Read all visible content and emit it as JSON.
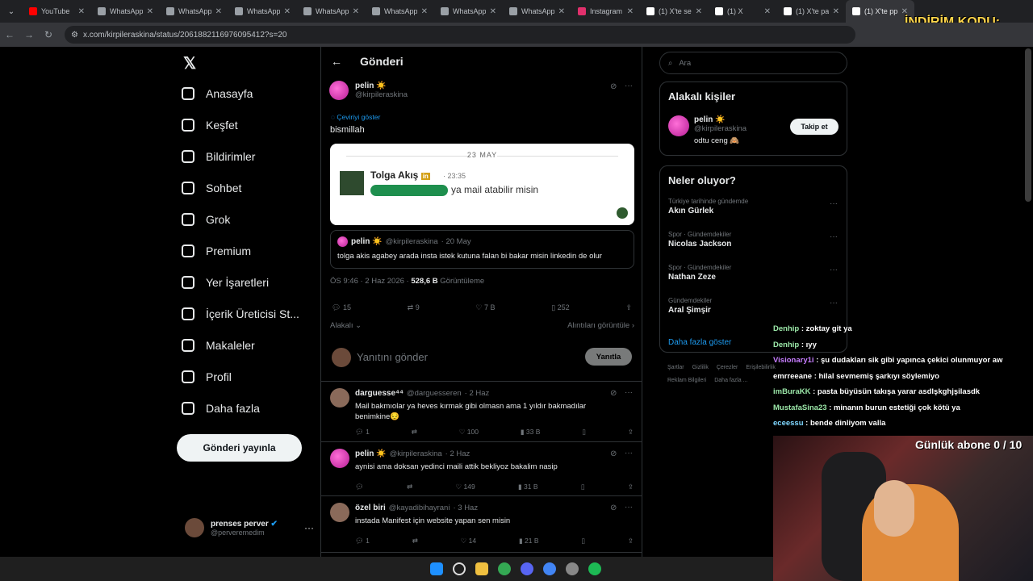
{
  "browser": {
    "tabs": [
      {
        "title": "YouTube",
        "color": "#ff0000"
      },
      {
        "title": "WhatsApp",
        "color": "#9aa0a6"
      },
      {
        "title": "WhatsApp",
        "color": "#9aa0a6"
      },
      {
        "title": "WhatsApp",
        "color": "#9aa0a6"
      },
      {
        "title": "WhatsApp",
        "color": "#9aa0a6"
      },
      {
        "title": "WhatsApp",
        "color": "#9aa0a6"
      },
      {
        "title": "WhatsApp",
        "color": "#9aa0a6"
      },
      {
        "title": "WhatsApp",
        "color": "#9aa0a6"
      },
      {
        "title": "Instagram",
        "color": "#e1306c"
      },
      {
        "title": "(1) X'te se",
        "color": "#ffffff"
      },
      {
        "title": "(1) X",
        "color": "#ffffff"
      },
      {
        "title": "(1) X'te pa",
        "color": "#ffffff"
      },
      {
        "title": "(1) X'te pp",
        "color": "#ffffff"
      }
    ],
    "url": "x.com/kirpileraskina/status/2061882116976095412?s=20",
    "promo": "İNDİRİM KODU: PERVER"
  },
  "nav": {
    "items": [
      "Anasayfa",
      "Keşfet",
      "Bildirimler",
      "Sohbet",
      "Grok",
      "Premium",
      "Yer İşaretleri",
      "İçerik Üreticisi St...",
      "Makaleler",
      "Profil",
      "Daha fazla"
    ],
    "post_button": "Gönderi yayınla",
    "account_name": "prenses perver",
    "account_handle": "@perveremedim"
  },
  "post": {
    "header": "Gönderi",
    "author_name": "pelin ☀️",
    "author_handle": "@kirpileraskina",
    "translate": "Çeviriyi göster",
    "text": "bismillah",
    "card": {
      "date": "23 MAY",
      "name": "Tolga Akış",
      "time": "23:35",
      "message": "ya mail atabilir misin"
    },
    "quote": {
      "name": "pelin ☀️",
      "handle": "@kirpileraskina",
      "date": "· 20 May",
      "text": "tolga akis agabey arada insta istek kutuna falan bi bakar misin linkedin de olur"
    },
    "time": "ÖS 9:46 · 2 Haz 2026 ·",
    "views_count": "528,6 B",
    "views_label": "Görüntüleme",
    "replies": "15",
    "reposts": "9",
    "likes": "7 B",
    "bookmarks": "252",
    "sort": "Alakalı",
    "quotes_link": "Alıntıları görüntüle"
  },
  "reply_box": {
    "placeholder": "Yanıtını gönder",
    "button": "Yanıtla"
  },
  "replies": [
    {
      "name": "darguesse⁴⁴",
      "handle": "@darguesseren",
      "date": "· 2 Haz",
      "text": "Mail bakmıolar ya heves kırmak gibi olmasn ama 1 yıldır bakmadılar benimkine😔",
      "r": "1",
      "l": "100",
      "v": "33 B"
    },
    {
      "name": "pelin ☀️",
      "handle": "@kirpileraskina",
      "date": "· 2 Haz",
      "text": "aynisi ama doksan yedinci maili attik bekliyoz bakalim nasip",
      "r": "",
      "l": "149",
      "v": "31 B"
    },
    {
      "name": "özel biri",
      "handle": "@kayadibihayrani",
      "date": "· 3 Haz",
      "text": "instada Manifest için website yapan sen misin",
      "r": "1",
      "l": "14",
      "v": "21 B"
    }
  ],
  "right": {
    "search_placeholder": "Ara",
    "related_title": "Alakalı kişiler",
    "related_name": "pelin ☀️",
    "related_handle": "@kirpileraskina",
    "related_bio": "odtu ceng 🙈",
    "follow": "Takip et",
    "trends_title": "Neler oluyor?",
    "trends": [
      {
        "cat": "Türkiye tarihinde gündemde",
        "name": "Akın Gürlek"
      },
      {
        "cat": "Spor · Gündemdekiler",
        "name": "Nicolas Jackson"
      },
      {
        "cat": "Spor · Gündemdekiler",
        "name": "Nathan Zeze"
      },
      {
        "cat": "Gündemdekiler",
        "name": "Aral Şimşir"
      }
    ],
    "more": "Daha fazla göster",
    "footer1": [
      "Şartlar",
      "Gizlilik",
      "Çerezler",
      "Erişilebilirlik"
    ],
    "footer2": [
      "Reklam Bilgileri",
      "Daha fazla ..."
    ]
  },
  "stream": {
    "chat": [
      {
        "user": "Denhip",
        "msg": ": zoktay git ya",
        "color": "#9be7a8"
      },
      {
        "user": "Denhip",
        "msg": ": ıyy",
        "color": "#9be7a8"
      },
      {
        "user": "Visionary1i",
        "msg": ": şu dudakları sik gibi yapınca çekici olunmuyor aw",
        "color": "#c77dff"
      },
      {
        "user": "emrreeane",
        "msg": ": hilal sevmemiş şarkıyı söylemiyo",
        "color": "#ffffff"
      },
      {
        "user": "imBuraKK",
        "msg": ": pasta büyüsün takışa yarar asdlşkghjşilasdk",
        "color": "#9be7a8"
      },
      {
        "user": "MustafaSina23",
        "msg": ": minanın burun estetiği çok kötü ya",
        "color": "#9be7a8"
      },
      {
        "user": "eceessu",
        "msg": ": bende dinliyom valla",
        "color": "#7fd7ff"
      }
    ],
    "subs": "Günlük abone 0 / 10"
  }
}
